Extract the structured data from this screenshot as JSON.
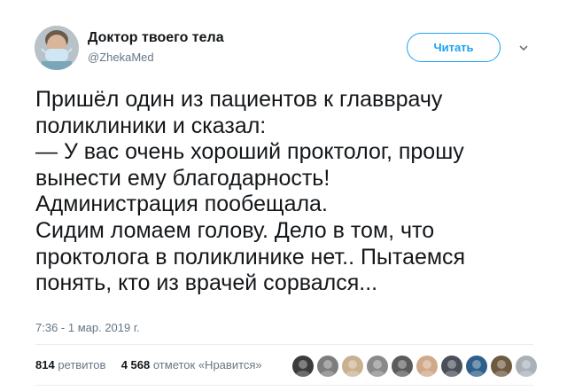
{
  "author": {
    "display_name": "Доктор твоего тела",
    "handle": "@ZhekaMed"
  },
  "follow_button_label": "Читать",
  "tweet": {
    "lines": [
      "Пришёл один из пациентов к главврачу",
      "поликлиники и сказал:",
      "— У вас очень хороший проктолог, прошу",
      "вынести ему благодарность!",
      "Администрация пообещала.",
      "Сидим ломаем голову. Дело в том, что",
      "проктолога в поликлинике нет.. Пытаемся",
      "понять, кто из врачей сорвался..."
    ],
    "timestamp": "7:36 - 1 мар. 2019 г."
  },
  "stats": {
    "retweets_count": "814",
    "retweets_label": "ретвитов",
    "likes_count": "4 568",
    "likes_label": "отметок «Нравится»"
  },
  "liker_avatars": [
    {
      "name": "liker-avatar-1",
      "color": "#3b3b3b"
    },
    {
      "name": "liker-avatar-2",
      "color": "#7d7d7d"
    },
    {
      "name": "liker-avatar-3",
      "color": "#c9b08f"
    },
    {
      "name": "liker-avatar-4",
      "color": "#8a8a8a"
    },
    {
      "name": "liker-avatar-5",
      "color": "#5b5b5b"
    },
    {
      "name": "liker-avatar-6",
      "color": "#d0a88a"
    },
    {
      "name": "liker-avatar-7",
      "color": "#4a4f5a"
    },
    {
      "name": "liker-avatar-8",
      "color": "#2f5f8a"
    },
    {
      "name": "liker-avatar-9",
      "color": "#6d5a3f"
    },
    {
      "name": "liker-avatar-10",
      "color": "#a8b0b8"
    }
  ],
  "colors": {
    "accent": "#1da1f2",
    "text": "#14171a",
    "muted": "#657786",
    "divider": "#e6ecf0"
  },
  "icons": {
    "caret": "chevron-down-icon",
    "avatar": "avatar"
  }
}
